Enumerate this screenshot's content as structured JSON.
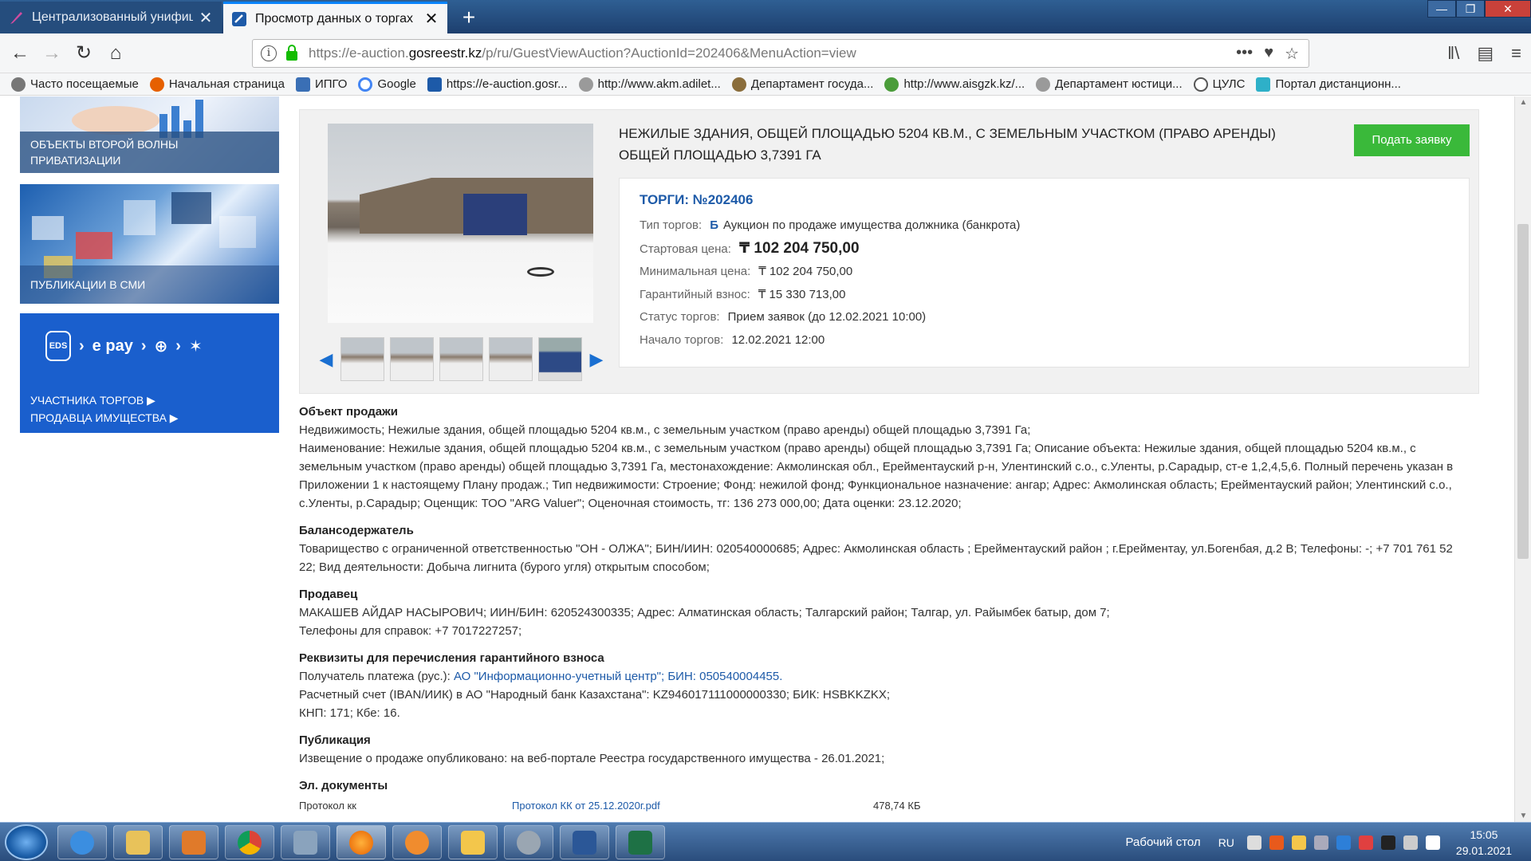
{
  "browser": {
    "tabs": [
      {
        "title": "Централизованный унифици",
        "active": false
      },
      {
        "title": "Просмотр данных о торгах",
        "active": true
      }
    ],
    "new_tab": "+",
    "url": {
      "prefix": "https://e-auction.",
      "host": "gosreestr.kz",
      "path": "/p/ru/GuestViewAuction?AuctionId=202406&MenuAction=view"
    },
    "url_actions": [
      "•••",
      "♥",
      "☆"
    ],
    "bookmarks": [
      {
        "label": "Часто посещаемые",
        "color": "#5a5a5a"
      },
      {
        "label": "Начальная страница",
        "color": "#e66000"
      },
      {
        "label": "ИПГО",
        "color": "#3a6fb5"
      },
      {
        "label": "Google",
        "color": "#4285f4"
      },
      {
        "label": "https://e-auction.gosr...",
        "color": "#1d5aa8"
      },
      {
        "label": "http://www.akm.adilet...",
        "color": "#8a8a8a"
      },
      {
        "label": "Департамент госуда...",
        "color": "#8a6d3b"
      },
      {
        "label": "http://www.aisgzk.kz/...",
        "color": "#4a9c3a"
      },
      {
        "label": "Департамент юстици...",
        "color": "#8a8a8a"
      },
      {
        "label": "ЦУЛС",
        "color": "#555555"
      },
      {
        "label": "Портал дистанционн...",
        "color": "#2e9e4a"
      }
    ]
  },
  "sidebar": {
    "banner1": "ОБЪЕКТЫ ВТОРОЙ ВОЛНЫ ПРИВАТИЗАЦИИ",
    "banner2": "ПУБЛИКАЦИИ В СМИ",
    "banner3_brand": "e pay",
    "banner3_eds": "EDS",
    "link_participants": "УЧАСТНИКА ТОРГОВ ▶",
    "link_sellers": "ПРОДАВЦА ИМУЩЕСТВА ▶"
  },
  "auction": {
    "title": "НЕЖИЛЫЕ ЗДАНИЯ, ОБЩЕЙ ПЛОЩАДЬЮ 5204 КВ.М., С ЗЕМЕЛЬНЫМ УЧАСТКОМ (ПРАВО АРЕНДЫ) ОБЩЕЙ ПЛОЩАДЬЮ 3,7391 ГА",
    "apply_button": "Подать заявку",
    "number": "ТОРГИ: №202406",
    "type_label": "Тип торгов:",
    "type_prefix": "Б",
    "type_value": "Аукцион по продаже имущества должника (банкрота)",
    "start_price_label": "Стартовая цена:",
    "start_price_value": "₸ 102 204 750,00",
    "min_price_label": "Минимальная цена:",
    "min_price_value": "₸ 102 204 750,00",
    "deposit_label": "Гарантийный взнос:",
    "deposit_value": "₸ 15 330 713,00",
    "status_label": "Статус торгов:",
    "status_value": "Прием заявок (до 12.02.2021 10:00)",
    "start_label": "Начало торгов:",
    "start_value": "12.02.2021 12:00"
  },
  "details": {
    "object_heading": "Объект продажи",
    "object_line1": "Недвижимость; Нежилые здания, общей площадью 5204 кв.м., с земельным участком (право аренды) общей площадью 3,7391 Га;",
    "object_line2": "Наименование: Нежилые здания, общей площадью 5204 кв.м., с земельным участком (право аренды) общей площадью 3,7391 Га; Описание объекта: Нежилые здания, общей площадью 5204 кв.м., с земельным участком (право аренды) общей площадью 3,7391 Га, местонахождение: Акмолинская обл., Ерейментауский р-н, Улентинский с.о., с.Уленты, р.Сарадыр, ст-е 1,2,4,5,6. Полный перечень указан в Приложении 1 к настоящему Плану продаж.; Тип недвижимости: Строение; Фонд: нежилой фонд; Функциональное назначение: ангар; Адрес: Акмолинская область; Ерейментауский район; Улентинский с.о., с.Уленты, р.Сарадыр; Оценщик: ТОО \"ARG Valuer\"; Оценочная стоимость, тг: 136 273 000,00; Дата оценки: 23.12.2020;",
    "holder_heading": "Балансодержатель",
    "holder_text": "Товарищество с ограниченной ответственностью \"ОН - ОЛЖА\"; БИН/ИИН: 020540000685; Адрес: Акмолинская область ; Ерейментауский район ; г.Ерейментау, ул.Богенбая, д.2 В; Телефоны: -; +7 701 761 52 22; Вид деятельности: Добыча лигнита (бурого угля) открытым способом;",
    "seller_heading": "Продавец",
    "seller_line1": "МАКАШЕВ АЙДАР НАСЫРОВИЧ; ИИН/БИН: 620524300335;  Адрес: Алматинская область; Талгарский район; Талгар, ул. Райымбек батыр, дом 7;",
    "seller_line2": "Телефоны для справок: +7 7017227257;",
    "req_heading": "Реквизиты для перечисления гарантийного взноса",
    "req_recipient_label": "Получатель платежа (рус.):",
    "req_recipient_value": "АО \"Информационно-учетный центр\"; БИН: 050540004455.",
    "req_account": "Расчетный счет (IBAN/ИИК) в АО \"Народный банк Казахстана\": KZ946017111000000330; БИК: HSBKKZKX;",
    "req_kbe": "КНП: 171; Кбе: 16.",
    "pub_heading": "Публикация",
    "pub_text": "Извещение о продаже опубликовано: на веб-портале Реестра государственного имущества - 26.01.2021;",
    "docs_heading": "Эл. документы",
    "doc_name": "Протокол кк",
    "doc_link": "Протокол КК от 25.12.2020г.pdf",
    "doc_size": "478,74 КБ"
  },
  "taskbar": {
    "apps": [
      {
        "name": "internet-explorer",
        "color": "#3b8ee0"
      },
      {
        "name": "explorer",
        "color": "#e8c25a"
      },
      {
        "name": "media-player",
        "color": "#e07a2a"
      },
      {
        "name": "chrome",
        "color": "#4caf50"
      },
      {
        "name": "calculator",
        "color": "#8aa3bd"
      },
      {
        "name": "firefox",
        "color": "#e66000"
      },
      {
        "name": "app-orange",
        "color": "#f08c2e"
      },
      {
        "name": "mail",
        "color": "#f3c64b"
      },
      {
        "name": "settings",
        "color": "#9aa6b2"
      },
      {
        "name": "word",
        "color": "#2b5797"
      },
      {
        "name": "excel",
        "color": "#1e7145"
      }
    ],
    "desktop": "Рабочий стол",
    "lang": "RU",
    "time": "15:05",
    "date": "29.01.2021"
  }
}
